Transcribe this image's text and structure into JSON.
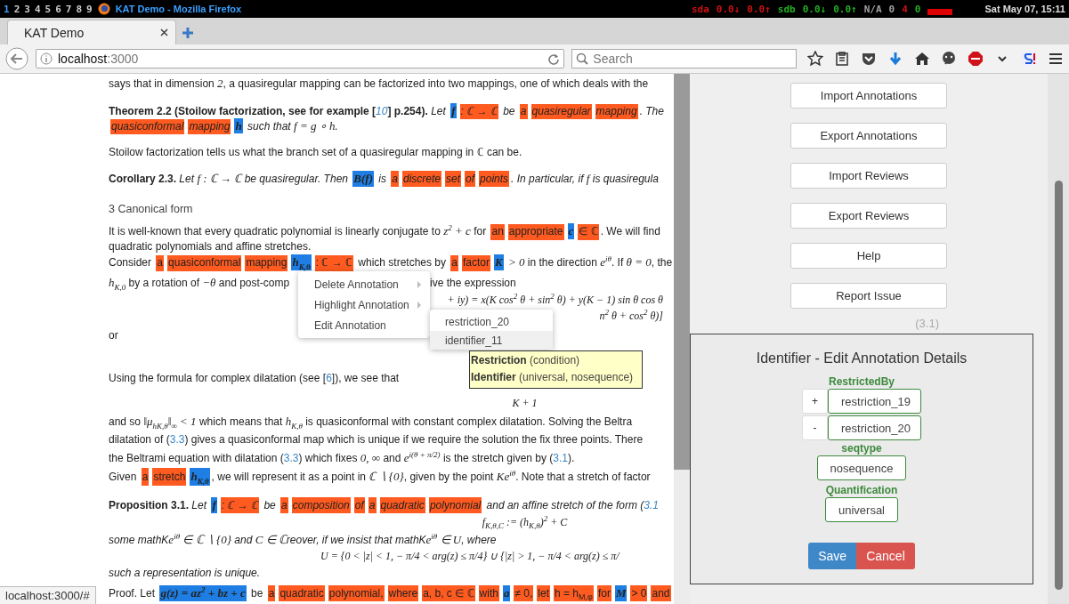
{
  "system_bar": {
    "workspaces": [
      "1",
      "2",
      "3",
      "4",
      "5",
      "6",
      "7",
      "8",
      "9"
    ],
    "window_title": "KAT Demo - Mozilla Firefox",
    "stats": [
      {
        "text": "sda",
        "color": "#d01010"
      },
      {
        "text": "0.0↓",
        "color": "#d01010"
      },
      {
        "text": "0.0↑",
        "color": "#d01010"
      },
      {
        "text": "sdb",
        "color": "#20b020"
      },
      {
        "text": "0.0↓",
        "color": "#20b020"
      },
      {
        "text": "0.0↑",
        "color": "#20b020"
      },
      {
        "text": "N/A",
        "color": "#a0a0a0"
      },
      {
        "text": "0",
        "color": "#a0a0a0"
      },
      {
        "text": "4",
        "color": "#d01010"
      },
      {
        "text": "0",
        "color": "#20b020"
      }
    ],
    "clock": "Sat May 07, 15:11"
  },
  "tabs": [
    {
      "label": "KAT Demo",
      "selected": true
    }
  ],
  "address_bar": {
    "host": "localhost",
    "port": ":3000"
  },
  "search": {
    "placeholder": "Search"
  },
  "document": [
    {
      "kind": "plain",
      "lines": [
        [
          {
            "kind": "text",
            "text": "says that in dimension "
          },
          {
            "kind": "math",
            "text": "2"
          },
          {
            "kind": "text",
            "text": ", a quasiregular mapping can be factorized into two mappings, one of which deals with the"
          }
        ]
      ]
    },
    {
      "kind": "theorem",
      "lines": [
        [
          {
            "kind": "bold",
            "text": "Theorem 2.2 (Stoilow factorization, see for example ["
          },
          {
            "kind": "link",
            "text": "10"
          },
          {
            "kind": "bold",
            "text": "] p.254)."
          },
          {
            "kind": "text",
            "text": " Let "
          },
          {
            "kind": "ident",
            "text": "f"
          },
          {
            "kind": "annot",
            "text": ": ℂ → ℂ"
          },
          {
            "kind": "text",
            "text": " be "
          },
          {
            "kind": "annot",
            "text": "a"
          },
          {
            "kind": "annot",
            "text": "quasiregular"
          },
          {
            "kind": "annot",
            "text": "mapping"
          },
          {
            "kind": "text",
            "text": ". The"
          }
        ],
        [
          {
            "kind": "annot",
            "text": "quasiconformal"
          },
          {
            "kind": "annot",
            "text": "mapping"
          },
          {
            "kind": "ident",
            "text": "h"
          },
          {
            "kind": "text",
            "text": " such that "
          },
          {
            "kind": "math",
            "text": "f = g ∘ h"
          },
          {
            "kind": "text",
            "text": "."
          }
        ]
      ]
    },
    {
      "kind": "plain",
      "lines": [
        [
          {
            "kind": "text",
            "text": "Stoilow factorization tells us what the branch set of a quasiregular mapping in ℂ can be."
          }
        ]
      ]
    },
    {
      "kind": "theorem",
      "lines": [
        [
          {
            "kind": "bold",
            "text": "Corollary 2.3."
          },
          {
            "kind": "text",
            "text": " Let "
          },
          {
            "kind": "math",
            "text": "f : ℂ → ℂ"
          },
          {
            "kind": "text",
            "text": " be quasiregular. Then "
          },
          {
            "kind": "ident",
            "text": "B(f)"
          },
          {
            "kind": "text",
            "text": " is "
          },
          {
            "kind": "annot",
            "text": "a"
          },
          {
            "kind": "annot",
            "text": "discrete"
          },
          {
            "kind": "annot",
            "text": "set"
          },
          {
            "kind": "annot",
            "text": "of"
          },
          {
            "kind": "annot",
            "text": "points"
          },
          {
            "kind": "text",
            "text": ". In particular, if "
          },
          {
            "kind": "math",
            "text": "f"
          },
          {
            "kind": "text",
            "text": " is quasiregula"
          }
        ]
      ]
    },
    {
      "kind": "heading",
      "lines": [
        [
          {
            "kind": "text",
            "text": "3 Canonical form"
          }
        ]
      ]
    },
    {
      "kind": "plain",
      "lines": [
        [
          {
            "kind": "text",
            "text": "It is well-known that every quadratic polynomial is linearly conjugate to "
          },
          {
            "kind": "math",
            "text": "z$^{2}$ + c"
          },
          {
            "kind": "text",
            "text": " for "
          },
          {
            "kind": "annot",
            "text": "an"
          },
          {
            "kind": "annot",
            "text": "appropriate"
          },
          {
            "kind": "ident",
            "text": "c"
          },
          {
            "kind": "annot",
            "text": "∈ ℂ"
          },
          {
            "kind": "text",
            "text": ". We will find"
          }
        ],
        [
          {
            "kind": "text",
            "text": "quadratic polynomials and affine stretches."
          }
        ],
        [
          {
            "kind": "text",
            "text": "Consider "
          },
          {
            "kind": "annot",
            "text": "a"
          },
          {
            "kind": "annot",
            "text": "quasiconformal"
          },
          {
            "kind": "annot",
            "text": "mapping"
          },
          {
            "kind": "ident",
            "text": "h$_{K,θ}$"
          },
          {
            "kind": "annot",
            "text": ": ℂ → ℂ"
          },
          {
            "kind": "text",
            "text": " which stretches by "
          },
          {
            "kind": "annot",
            "text": "a"
          },
          {
            "kind": "annot",
            "text": "factor"
          },
          {
            "kind": "ident",
            "text": "K"
          },
          {
            "kind": "math",
            "text": " > 0"
          },
          {
            "kind": "text",
            "text": " in the direction "
          },
          {
            "kind": "math",
            "text": "e$^{iθ}$"
          },
          {
            "kind": "text",
            "text": ". If "
          },
          {
            "kind": "math",
            "text": "θ = 0"
          },
          {
            "kind": "text",
            "text": ", the"
          }
        ]
      ]
    },
    {
      "kind": "split",
      "lines": [
        [
          {
            "kind": "math",
            "text": "h$_{K,0}$"
          },
          {
            "kind": "text",
            "text": " by a rotation of "
          },
          {
            "kind": "math",
            "text": "−θ"
          },
          {
            "kind": "text",
            "text": " and post-comp"
          }
        ],
        [
          {
            "kind": "text",
            "text": "ive the expression"
          }
        ]
      ]
    },
    {
      "kind": "display",
      "lines": [
        [
          {
            "kind": "math",
            "text": "+ iy) = x(K cos$^{2}$ θ + sin$^{2}$ θ) + y(K − 1) sin θ cos θ"
          }
        ],
        [
          {
            "kind": "math",
            "text": "n$^{2}$ θ + cos$^{2}$ θ)]"
          }
        ]
      ]
    },
    {
      "kind": "plain",
      "lines": [
        [
          {
            "kind": "text",
            "text": "or"
          }
        ]
      ]
    },
    {
      "kind": "plain",
      "lines": [
        [
          {
            "kind": "text",
            "text": "Using the formula for complex dilatation (see ["
          },
          {
            "kind": "link",
            "text": "6"
          },
          {
            "kind": "text",
            "text": "]), we see that"
          }
        ]
      ]
    },
    {
      "kind": "display",
      "lines": [
        [
          {
            "kind": "math",
            "text": "K + 1"
          }
        ]
      ]
    },
    {
      "kind": "plain",
      "lines": [
        [
          {
            "kind": "text",
            "text": "and so "
          },
          {
            "kind": "math",
            "text": "‖μ$_{hK,θ}$‖$_{∞}$ < 1"
          },
          {
            "kind": "text",
            "text": " which means that "
          },
          {
            "kind": "math",
            "text": "h$_{K,θ}$"
          },
          {
            "kind": "text",
            "text": " is quasiconformal with constant complex dilatation. Solving the Beltra"
          }
        ],
        [
          {
            "kind": "text",
            "text": "dilatation of ("
          },
          {
            "kind": "link",
            "text": "3.3"
          },
          {
            "kind": "text",
            "text": ") gives a quasiconformal map which is unique if we require the solution the fix three points. There"
          }
        ],
        [
          {
            "kind": "text",
            "text": "the Beltrami equation with dilatation ("
          },
          {
            "kind": "link",
            "text": "3.3"
          },
          {
            "kind": "text",
            "text": ") which fixes "
          },
          {
            "kind": "math",
            "text": "0, ∞"
          },
          {
            "kind": "text",
            "text": " and "
          },
          {
            "kind": "math",
            "text": "e$^{i(θ + π/2)}$"
          },
          {
            "kind": "text",
            "text": " is the stretch given by ("
          },
          {
            "kind": "link",
            "text": "3.1"
          },
          {
            "kind": "text",
            "text": ")."
          }
        ],
        [
          {
            "kind": "text",
            "text": "Given "
          },
          {
            "kind": "annot",
            "text": "a"
          },
          {
            "kind": "annot",
            "text": "stretch"
          },
          {
            "kind": "ident",
            "text": "h$_{K,θ}$"
          },
          {
            "kind": "text",
            "text": ", we will represent it as a point in "
          },
          {
            "kind": "math",
            "text": "ℂ ∖ {0}"
          },
          {
            "kind": "text",
            "text": ", given by the point "
          },
          {
            "kind": "math",
            "text": "Ke$^{iθ}$"
          },
          {
            "kind": "text",
            "text": ". Note that a stretch of factor"
          }
        ]
      ]
    },
    {
      "kind": "theorem",
      "lines": [
        [
          {
            "kind": "bold",
            "text": "Proposition 3.1."
          },
          {
            "kind": "text",
            "text": " Let "
          },
          {
            "kind": "ident",
            "text": "f"
          },
          {
            "kind": "annot",
            "text": ": ℂ → ℂ"
          },
          {
            "kind": "text",
            "text": " be "
          },
          {
            "kind": "annot",
            "text": "a"
          },
          {
            "kind": "annot",
            "text": "composition"
          },
          {
            "kind": "annot",
            "text": "of"
          },
          {
            "kind": "annot",
            "text": "a"
          },
          {
            "kind": "annot",
            "text": "quadratic"
          },
          {
            "kind": "annot",
            "text": "polynomial"
          },
          {
            "kind": "text",
            "text": " and an affine stretch of the form ("
          },
          {
            "kind": "link",
            "text": "3.1"
          }
        ]
      ]
    },
    {
      "kind": "display",
      "lines": [
        [
          {
            "kind": "math",
            "text": "f$_{K,θ,C}$ := (h$_{K,θ}$)$^{2}$ + C"
          }
        ]
      ]
    },
    {
      "kind": "theorem",
      "lines": [
        [
          {
            "kind": "text",
            "text": "some mathK"
          },
          {
            "kind": "math",
            "text": "e$^{iθ}$ ∈ ℂ ∖ {0}"
          },
          {
            "kind": "text",
            "text": " and "
          },
          {
            "kind": "math",
            "text": "C ∈ ℂ"
          },
          {
            "kind": "text",
            "text": "reover, if we insist that mathK"
          },
          {
            "kind": "math",
            "text": "e$^{iθ}$ ∈ U"
          },
          {
            "kind": "text",
            "text": ", where"
          }
        ]
      ]
    },
    {
      "kind": "display",
      "lines": [
        [
          {
            "kind": "math",
            "text": "U = {0 < |z| < 1, − π/4 < arg(z) ≤ π/4} ∪ {|z| > 1, − π/4 < arg(z) ≤ π/"
          }
        ]
      ]
    },
    {
      "kind": "theorem",
      "lines": [
        [
          {
            "kind": "text",
            "text": "such a representation is unique."
          }
        ]
      ]
    },
    {
      "kind": "plain",
      "lines": [
        [
          {
            "kind": "text",
            "text": "Proof. Let "
          },
          {
            "kind": "ident",
            "text": "g(z) = az$^{2}$ + bz + c"
          },
          {
            "kind": "text",
            "text": " be "
          },
          {
            "kind": "annot",
            "text": "a"
          },
          {
            "kind": "annot",
            "text": "quadratic"
          },
          {
            "kind": "annot",
            "text": "polynomial,"
          },
          {
            "kind": "annot",
            "text": "where"
          },
          {
            "kind": "annot",
            "text": "a, b, c ∈ ℂ"
          },
          {
            "kind": "annot",
            "text": "with"
          },
          {
            "kind": "ident",
            "text": "a"
          },
          {
            "kind": "annot",
            "text": "≠ 0,"
          },
          {
            "kind": "annot",
            "text": "let"
          },
          {
            "kind": "annot",
            "text": "h = h$_{M,φ}$"
          },
          {
            "kind": "annot",
            "text": "for"
          },
          {
            "kind": "ident",
            "text": "M"
          },
          {
            "kind": "annot",
            "text": "> 0"
          },
          {
            "kind": "annot",
            "text": "and"
          }
        ]
      ]
    }
  ],
  "context_menu": {
    "items": [
      {
        "label": "Delete Annotation",
        "submenu": true
      },
      {
        "label": "Highlight Annotation",
        "submenu": true
      },
      {
        "label": "Edit Annotation",
        "submenu": false
      }
    ],
    "submenu": [
      {
        "label": "restriction_20",
        "selected": false
      },
      {
        "label": "identifier_11",
        "selected": true
      }
    ],
    "tooltip": [
      "**Restriction** (condition)",
      "**Identifier** (universal, nosequence)"
    ]
  },
  "panel": {
    "buttons": [
      "Import Annotations",
      "Export Annotations",
      "Import Reviews",
      "Export Reviews",
      "Help",
      "Report Issue"
    ],
    "equation_number": "(3.1)",
    "dialog": {
      "title": "Identifier - Edit Annotation Details",
      "fields": [
        {
          "label": "RestrictedBy",
          "kind": "list",
          "rows": [
            {
              "action": "+",
              "value": "restriction_19"
            },
            {
              "action": "-",
              "value": "restriction_20"
            }
          ]
        },
        {
          "label": "seqtype",
          "kind": "single",
          "value": "nosequence"
        },
        {
          "label": "Quantification",
          "kind": "single",
          "value": "universal"
        }
      ],
      "actions": [
        {
          "label": "Save",
          "kind": "primary"
        },
        {
          "label": "Cancel",
          "kind": "danger"
        }
      ]
    }
  },
  "status": "localhost:3000/#"
}
